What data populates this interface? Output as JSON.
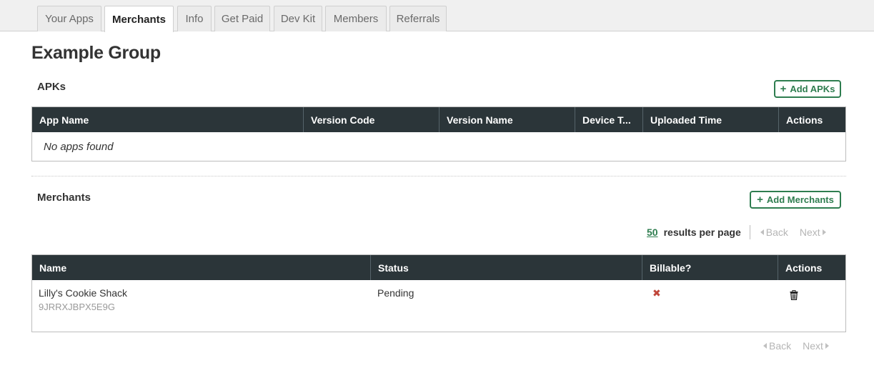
{
  "tabs": [
    {
      "label": "Your Apps",
      "active": false
    },
    {
      "label": "Merchants",
      "active": true
    },
    {
      "label": "Info",
      "active": false
    },
    {
      "label": "Get Paid",
      "active": false
    },
    {
      "label": "Dev Kit",
      "active": false
    },
    {
      "label": "Members",
      "active": false
    },
    {
      "label": "Referrals",
      "active": false
    }
  ],
  "page": {
    "title": "Example Group"
  },
  "apks": {
    "title": "APKs",
    "add_label": "Add APKs",
    "columns": [
      "App Name",
      "Version Code",
      "Version Name",
      "Device T...",
      "Uploaded Time",
      "Actions"
    ],
    "empty_text": "No apps found"
  },
  "merchants": {
    "title": "Merchants",
    "add_label": "Add Merchants",
    "per_page": "50",
    "per_page_label": "results per page",
    "back_label": "Back",
    "next_label": "Next",
    "columns": [
      "Name",
      "Status",
      "Billable?",
      "Actions"
    ],
    "rows": [
      {
        "name": "Lilly's Cookie Shack",
        "id": "9JRRXJBPX5E9G",
        "status": "Pending",
        "billable": "✖"
      }
    ]
  },
  "colors": {
    "accent": "#2e7d4f",
    "header_bg": "#2b3539",
    "x_red": "#c0463a"
  }
}
